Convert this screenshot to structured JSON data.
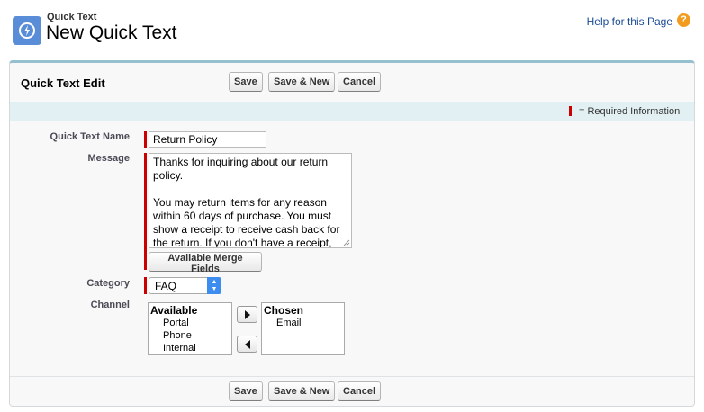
{
  "header": {
    "object_label": "Quick Text",
    "title": "New Quick Text",
    "help_link": "Help for this Page",
    "help_icon_glyph": "?",
    "icon": "quick-text-bolt-icon",
    "accent_color": "#5a8dd8"
  },
  "section": {
    "title": "Quick Text Edit",
    "required_info": "= Required Information"
  },
  "toolbar": {
    "save_label": "Save",
    "save_new_label": "Save & New",
    "cancel_label": "Cancel"
  },
  "form": {
    "name_label": "Quick Text Name",
    "name_value": "Return Policy",
    "message_label": "Message",
    "message_paragraphs": [
      "Thanks for inquiring about our return policy.",
      "You may return items for any reason within 60 days of purchase. You must show a receipt to receive cash back for the return. If you don't have a receipt, we'll issue you a store credit."
    ],
    "merge_fields_label": "Available Merge Fields",
    "category_label": "Category",
    "category_value": "FAQ",
    "channel_label": "Channel",
    "available_header": "Available",
    "available_options": [
      "Portal",
      "Phone",
      "Internal"
    ],
    "chosen_header": "Chosen",
    "chosen_options": [
      "Email"
    ]
  },
  "colors": {
    "required": "#cc0000",
    "panel_border": "#96c0d0",
    "select_arrow": "#3d8cf0"
  }
}
